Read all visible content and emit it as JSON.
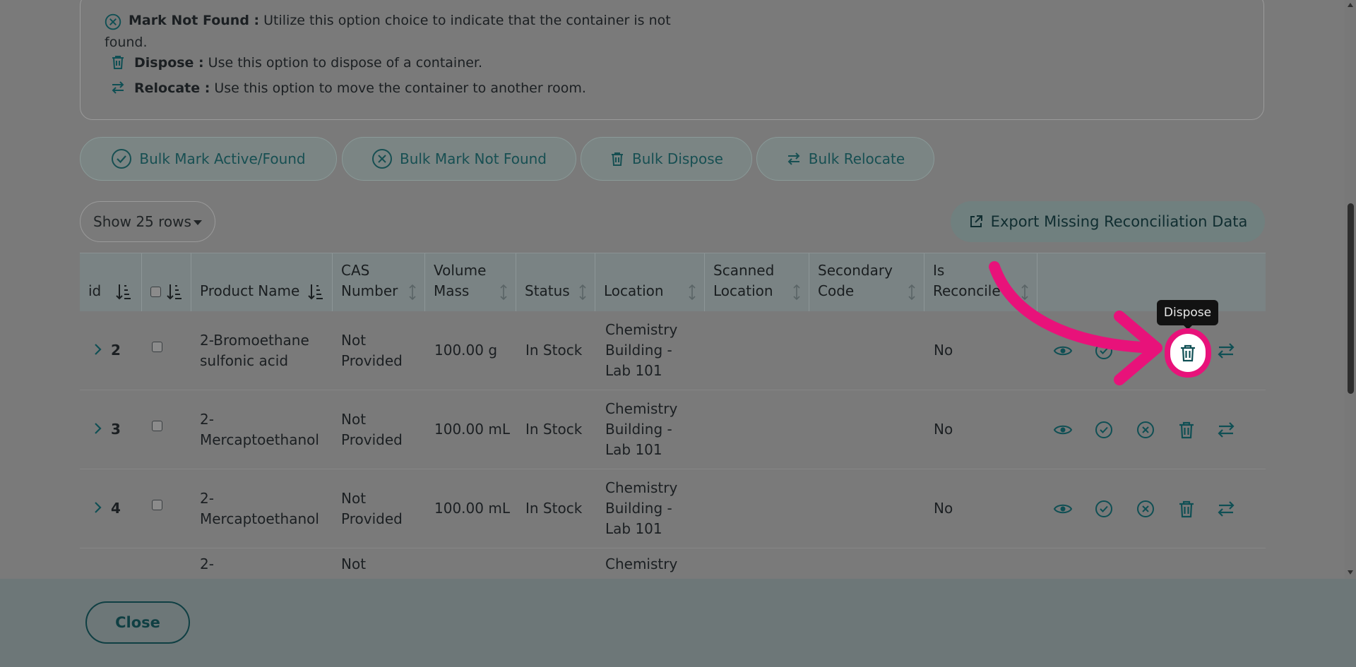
{
  "info": {
    "not_found_label": "Mark Not Found :",
    "not_found_text": "Utilize this option choice to indicate that the container is not",
    "not_found_text_cont": "found.",
    "dispose_label": "Dispose :",
    "dispose_text": "Use this option to dispose of a container.",
    "relocate_label": "Relocate :",
    "relocate_text": "Use this option to move the container to another room."
  },
  "bulk": {
    "active": "Bulk Mark Active/Found",
    "not_found": "Bulk Mark Not Found",
    "dispose": "Bulk Dispose",
    "relocate": "Bulk Relocate"
  },
  "rows_select": "Show 25 rows",
  "export_label": "Export Missing Reconciliation Data",
  "columns": {
    "id": "id",
    "product_name": "Product Name",
    "cas_1": "CAS",
    "cas_2": "Number",
    "volume_1": "Volume",
    "volume_2": "Mass",
    "status": "Status",
    "location": "Location",
    "scanned_1": "Scanned",
    "scanned_2": "Location",
    "secondary_1": "Secondary",
    "secondary_2": "Code",
    "recon_1": "Is",
    "recon_2": "Reconcile"
  },
  "rows": [
    {
      "id": "2",
      "name_1": "2-Bromoethane",
      "name_2": "sulfonic acid",
      "cas_1": "Not",
      "cas_2": "Provided",
      "volume": "100.00 g",
      "status": "In Stock",
      "loc_1": "Chemistry",
      "loc_2": "Building -",
      "loc_3": "Lab 101",
      "recon": "No"
    },
    {
      "id": "3",
      "name_1": "2-",
      "name_2": "Mercaptoethanol",
      "cas_1": "Not",
      "cas_2": "Provided",
      "volume": "100.00 mL",
      "status": "In Stock",
      "loc_1": "Chemistry",
      "loc_2": "Building -",
      "loc_3": "Lab 101",
      "recon": "No"
    },
    {
      "id": "4",
      "name_1": "2-",
      "name_2": "Mercaptoethanol",
      "cas_1": "Not",
      "cas_2": "Provided",
      "volume": "100.00 mL",
      "status": "In Stock",
      "loc_1": "Chemistry",
      "loc_2": "Building -",
      "loc_3": "Lab 101",
      "recon": "No"
    },
    {
      "id": "",
      "name_1": "2-",
      "name_2": "",
      "cas_1": "Not",
      "cas_2": "",
      "volume": "",
      "status": "",
      "loc_1": "Chemistry",
      "loc_2": "",
      "loc_3": "",
      "recon": ""
    }
  ],
  "tooltip": "Dispose",
  "close_label": "Close",
  "colors": {
    "accent": "#0f5a60",
    "highlight": "#e8127a",
    "overlay": "#7a7a7a"
  }
}
